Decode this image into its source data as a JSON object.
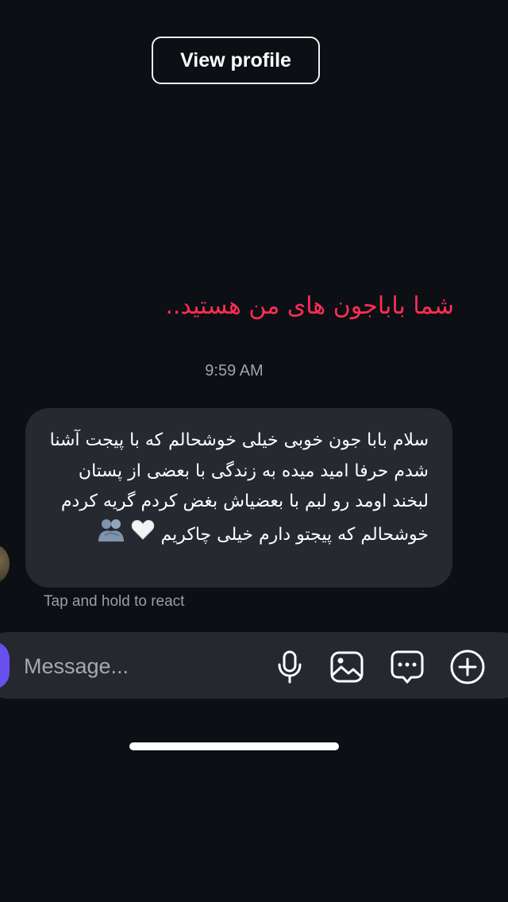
{
  "header": {
    "view_profile_label": "View profile"
  },
  "thread": {
    "outgoing_message": "شما باباجون های من هستید..",
    "timestamp": "9:59 AM",
    "incoming_message": {
      "text": "سلام بابا جون خوبی خیلی خوشحالم که با پیجت آشنا شدم حرفا امید میده به زندگی با بعضی از پستان لبخند اومد رو لبم با بعضیاش بغض کردم گریه کردم خوشحالم که پیجتو دارم خیلی چاکریم",
      "emoji": [
        "white-heart-icon",
        "people-hugging-icon"
      ]
    },
    "react_hint": "Tap and hold to react"
  },
  "composer": {
    "placeholder": "Message...",
    "icons": [
      "microphone-icon",
      "image-icon",
      "sticker-chat-icon",
      "add-icon"
    ]
  },
  "colors": {
    "background": "#0c0f14",
    "outgoing_text": "#ff2d55",
    "bubble": "#262a30",
    "composer": "#25282e",
    "camera_button": "#6a4ff0"
  }
}
